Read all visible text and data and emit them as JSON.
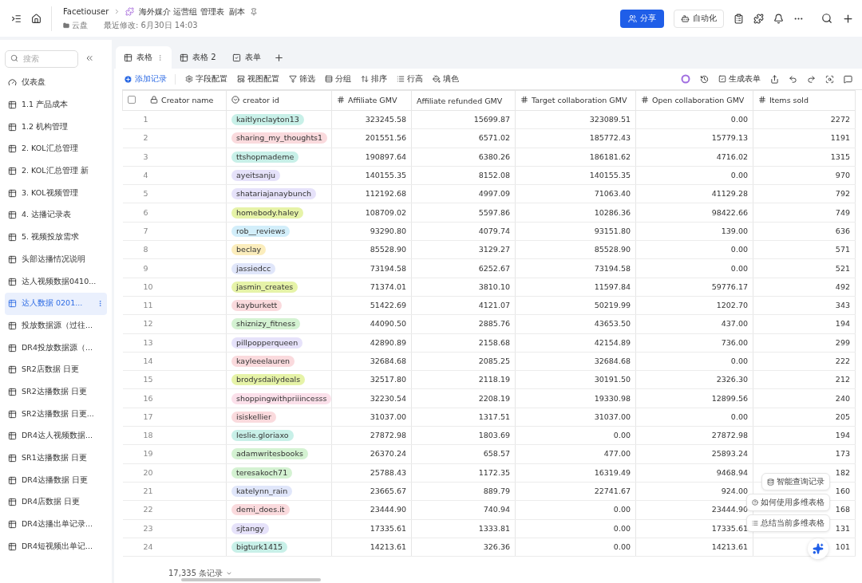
{
  "header": {
    "breadcrumb_root": "Facetiouser",
    "doc_title": "海外媒介 运营组 管理表  副本",
    "location": "云盘",
    "modified": "最近修改: 6月30日 14:03",
    "share_button": "分享",
    "automation_button": "自动化"
  },
  "sidebar": {
    "search_placeholder": "搜索",
    "items": [
      {
        "label": "仪表盘",
        "kind": "dashboard",
        "selected": false
      },
      {
        "label": "1.1 产品成本",
        "kind": "table",
        "selected": false
      },
      {
        "label": "1.2 机构管理",
        "kind": "table",
        "selected": false
      },
      {
        "label": "2. KOL汇总管理",
        "kind": "table",
        "selected": false
      },
      {
        "label": "2. KOL汇总管理 新",
        "kind": "table",
        "selected": false
      },
      {
        "label": "3. KOL视频管理",
        "kind": "table",
        "selected": false
      },
      {
        "label": "4. 达播记录表",
        "kind": "table",
        "selected": false
      },
      {
        "label": "5. 视频投放需求",
        "kind": "table",
        "selected": false
      },
      {
        "label": "头部达播情况说明",
        "kind": "table",
        "selected": false
      },
      {
        "label": "达人视频数据0410...",
        "kind": "table",
        "selected": false
      },
      {
        "label": "达人数据 0201...",
        "kind": "table",
        "selected": true
      },
      {
        "label": "投放数据源（过往...",
        "kind": "table",
        "selected": false
      },
      {
        "label": "DR4投放数据源（...",
        "kind": "table",
        "selected": false
      },
      {
        "label": "SR2店数据 日更",
        "kind": "table",
        "selected": false
      },
      {
        "label": "SR2达播数据 日更",
        "kind": "table",
        "selected": false
      },
      {
        "label": "SR2达播数据 日更...",
        "kind": "table",
        "selected": false
      },
      {
        "label": "DR4达人视频数据...",
        "kind": "table",
        "selected": false
      },
      {
        "label": "SR1达播数据 日更",
        "kind": "table",
        "selected": false
      },
      {
        "label": "DR4达播数据 日更",
        "kind": "table",
        "selected": false
      },
      {
        "label": "DR4店数据 日更",
        "kind": "table",
        "selected": false
      },
      {
        "label": "DR4达播出单记录...",
        "kind": "table",
        "selected": false
      },
      {
        "label": "DR4短视频出单记...",
        "kind": "table",
        "selected": false
      }
    ]
  },
  "tabs": [
    {
      "label": "表格",
      "kind": "grid",
      "selected": true
    },
    {
      "label": "表格 2",
      "kind": "grid",
      "selected": false
    },
    {
      "label": "表单",
      "kind": "form",
      "selected": false
    }
  ],
  "toolbar": {
    "add_record": "添加记录",
    "items": [
      {
        "label": "字段配置",
        "kind": "gear"
      },
      {
        "label": "视图配置",
        "kind": "view"
      },
      {
        "label": "筛选",
        "kind": "filter"
      },
      {
        "label": "分组",
        "kind": "group"
      },
      {
        "label": "排序",
        "kind": "sort"
      },
      {
        "label": "行高",
        "kind": "height"
      },
      {
        "label": "填色",
        "kind": "paint"
      }
    ],
    "generate_form": "生成表单"
  },
  "table": {
    "select_all_checked": false,
    "columns": [
      {
        "label": "Creator name",
        "kind": "lock"
      },
      {
        "label": "creator id",
        "kind": "option"
      },
      {
        "label": "Affiliate GMV",
        "kind": "number"
      },
      {
        "label": "Affiliate refunded GMV",
        "kind": "plain"
      },
      {
        "label": "Target collaboration GMV",
        "kind": "number"
      },
      {
        "label": "Open collaboration GMV",
        "kind": "number"
      },
      {
        "label": "Items sold",
        "kind": "number"
      }
    ],
    "rows": [
      {
        "n": "1",
        "creator_id": "kaitlynclayton13",
        "color": "#c8f0e8",
        "values": [
          "323245.58",
          "15699.87",
          "323089.51",
          "0.00",
          "2272"
        ]
      },
      {
        "n": "2",
        "creator_id": "sharing_my_thoughts1",
        "color": "#fadadd",
        "values": [
          "201551.56",
          "6571.02",
          "185772.43",
          "15779.13",
          "1191"
        ]
      },
      {
        "n": "3",
        "creator_id": "ttshopmademe",
        "color": "#c8f0e8",
        "values": [
          "190897.64",
          "6380.26",
          "186181.62",
          "4716.02",
          "1315"
        ]
      },
      {
        "n": "4",
        "creator_id": "ayeitsanju",
        "color": "#e6e2fa",
        "values": [
          "140155.35",
          "8152.08",
          "140155.35",
          "0.00",
          "970"
        ]
      },
      {
        "n": "5",
        "creator_id": "shatariajanaybunch",
        "color": "#e6e2fa",
        "values": [
          "112192.68",
          "4997.09",
          "71063.40",
          "41129.28",
          "792"
        ]
      },
      {
        "n": "6",
        "creator_id": "homebody.haley",
        "color": "#e6f3a8",
        "values": [
          "108709.02",
          "5597.86",
          "10286.36",
          "98422.66",
          "749"
        ]
      },
      {
        "n": "7",
        "creator_id": "rob__reviews",
        "color": "#d2eefa",
        "values": [
          "93290.80",
          "4079.74",
          "93151.80",
          "139.00",
          "636"
        ]
      },
      {
        "n": "8",
        "creator_id": "beclay",
        "color": "#fbedbc",
        "values": [
          "85528.90",
          "3129.27",
          "85528.90",
          "0.00",
          "571"
        ]
      },
      {
        "n": "9",
        "creator_id": "jassiedcc",
        "color": "#e0e6fa",
        "values": [
          "73194.58",
          "6252.67",
          "73194.58",
          "0.00",
          "521"
        ]
      },
      {
        "n": "10",
        "creator_id": "jasmin_creates",
        "color": "#e6f3a8",
        "values": [
          "71374.01",
          "3810.10",
          "11597.84",
          "59776.17",
          "492"
        ]
      },
      {
        "n": "11",
        "creator_id": "kayburkett",
        "color": "#fadadd",
        "values": [
          "51422.69",
          "4121.07",
          "50219.99",
          "1202.70",
          "343"
        ]
      },
      {
        "n": "12",
        "creator_id": "shiznizy_fitness",
        "color": "#d4f2d2",
        "values": [
          "44090.50",
          "2885.76",
          "43653.50",
          "437.00",
          "194"
        ]
      },
      {
        "n": "13",
        "creator_id": "pillpopperqueen",
        "color": "#e6e2fa",
        "values": [
          "42890.89",
          "2158.68",
          "42154.89",
          "736.00",
          "299"
        ]
      },
      {
        "n": "14",
        "creator_id": "kayleeelauren",
        "color": "#fadadd",
        "values": [
          "32684.68",
          "2085.25",
          "32684.68",
          "0.00",
          "222"
        ]
      },
      {
        "n": "15",
        "creator_id": "brodysdailydeals",
        "color": "#e6f3a8",
        "values": [
          "32517.80",
          "2118.19",
          "30191.50",
          "2326.30",
          "212"
        ]
      },
      {
        "n": "16",
        "creator_id": "shoppingwithpriiincesss",
        "color": "#fbe0ea",
        "values": [
          "32230.54",
          "2208.19",
          "19330.98",
          "12899.56",
          "240"
        ]
      },
      {
        "n": "17",
        "creator_id": "isiskellier",
        "color": "#fadadd",
        "values": [
          "31037.00",
          "1317.51",
          "31037.00",
          "0.00",
          "205"
        ]
      },
      {
        "n": "18",
        "creator_id": "leslie.gloriaxo",
        "color": "#c8f0e8",
        "values": [
          "27872.98",
          "1803.69",
          "0.00",
          "27872.98",
          "194"
        ]
      },
      {
        "n": "19",
        "creator_id": "adamwritesbooks",
        "color": "#d4f2d2",
        "values": [
          "26370.24",
          "658.57",
          "477.00",
          "25893.24",
          "173"
        ]
      },
      {
        "n": "20",
        "creator_id": "teresakoch71",
        "color": "#d4f2d2",
        "values": [
          "25788.43",
          "1172.35",
          "16319.49",
          "9468.94",
          "182"
        ]
      },
      {
        "n": "21",
        "creator_id": "katelynn_rain",
        "color": "#e0e6fa",
        "values": [
          "23665.67",
          "889.79",
          "22741.67",
          "924.00",
          "160"
        ]
      },
      {
        "n": "22",
        "creator_id": "demi_does.it",
        "color": "#fadadd",
        "values": [
          "23444.90",
          "740.94",
          "0.00",
          "23444.90",
          "168"
        ]
      },
      {
        "n": "23",
        "creator_id": "sjtangy",
        "color": "#e6e2fa",
        "values": [
          "17335.61",
          "1333.81",
          "0.00",
          "17335.61",
          "131"
        ]
      },
      {
        "n": "24",
        "creator_id": "bigturk1415",
        "color": "#c8f0e8",
        "values": [
          "14213.61",
          "326.36",
          "0.00",
          "14213.61",
          "101"
        ]
      }
    ]
  },
  "footer": {
    "record_count": "17,335 条记录"
  },
  "assistant": {
    "suggestions": [
      {
        "label": "智能查询记录",
        "kind": "db"
      },
      {
        "label": "如何使用多维表格",
        "kind": "help"
      },
      {
        "label": "总结当前多维表格",
        "kind": "list"
      }
    ]
  }
}
